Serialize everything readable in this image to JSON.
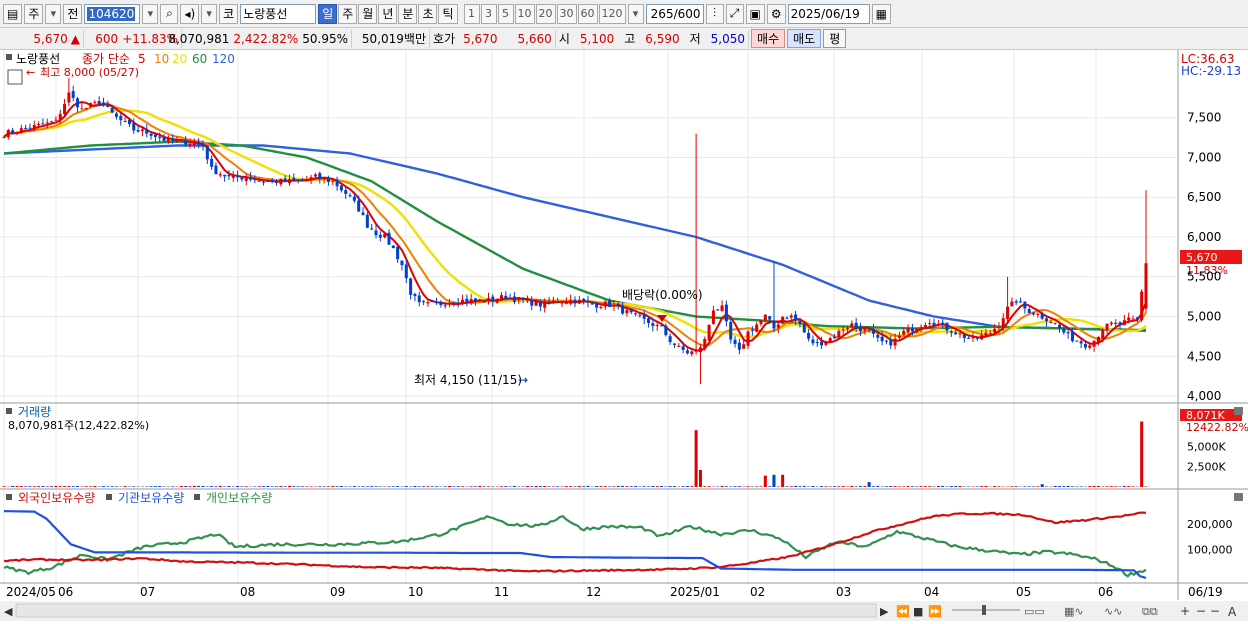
{
  "toolbar": {
    "market_label": "주",
    "prev_label": "전",
    "code_value": "104620",
    "kosdaq_label": "코",
    "name_value": "노랑풍선",
    "periods": [
      "일",
      "주",
      "월",
      "년",
      "분",
      "초",
      "틱"
    ],
    "active_period": "일",
    "intervals": [
      "1",
      "3",
      "5",
      "10",
      "20",
      "30",
      "60",
      "120"
    ],
    "count_value": "265",
    "count_total": "/600",
    "date_value": "2025/06/19"
  },
  "quote": {
    "price": "5,670",
    "up_arrow": "▲",
    "change": "600",
    "change_pct": "+11.83%",
    "volume": "8,070,981",
    "volume_ratio": "2,422.82%",
    "turnover": "50.95%",
    "amount": "50,019백만",
    "bid_label": "호가",
    "ask": "5,670",
    "bid": "5,660",
    "open_label": "시",
    "open": "5,100",
    "high_label": "고",
    "high": "6,590",
    "low_label": "저",
    "low": "5,050",
    "buy_label": "매수",
    "sell_label": "매도",
    "eval_label": "평"
  },
  "price_panel": {
    "stock_name": "노랑풍선",
    "legend_prefix": "종가 단순",
    "ma_periods": [
      "5",
      "10",
      "20",
      "60",
      "120"
    ],
    "ma_colors": [
      "#e00000",
      "#f08000",
      "#f0e000",
      "#209040",
      "#3060e0"
    ],
    "high_annotation": "최고 8,000 (05/27)",
    "low_annotation": "최저 4,150 (11/15)",
    "dividend_annotation": "배당락(0.00%)",
    "lc_label": "LC:36.63",
    "hc_label": "HC:-29.13",
    "current_price_tag": "5,670",
    "current_change_tag": "11.83%",
    "y_ticks": [
      "7,500",
      "7,000",
      "6,500",
      "6,000",
      "5,500",
      "5,000",
      "4,500",
      "4,000"
    ]
  },
  "volume_panel": {
    "title": "거래량",
    "summary": "8,070,981주(12,422.82%)",
    "current_tag": "8,071K",
    "current_pct": "12422.82%",
    "y_ticks": [
      "5,000K",
      "2,500K"
    ]
  },
  "holding_panel": {
    "legend": [
      "외국인보유수량",
      "기관보유수량",
      "개인보유수량"
    ],
    "colors": [
      "#d01010",
      "#2050e0",
      "#309050"
    ],
    "y_ticks": [
      "200,000",
      "100,000"
    ]
  },
  "x_axis": {
    "labels": [
      "2024/05",
      "06",
      "07",
      "08",
      "09",
      "10",
      "11",
      "12",
      "2025/01",
      "02",
      "03",
      "04",
      "05",
      "06"
    ],
    "right_label": "06/19"
  },
  "chart_data": {
    "type": "candlestick",
    "y_range": [
      3950,
      8100
    ],
    "price_anchors": [
      [
        0,
        7300
      ],
      [
        4,
        7350
      ],
      [
        8,
        7400
      ],
      [
        12,
        7450
      ],
      [
        15,
        7800
      ],
      [
        18,
        7600
      ],
      [
        22,
        7700
      ],
      [
        26,
        7500
      ],
      [
        30,
        7350
      ],
      [
        34,
        7300
      ],
      [
        38,
        7200
      ],
      [
        42,
        7200
      ],
      [
        46,
        7150
      ],
      [
        48,
        6850
      ],
      [
        52,
        6750
      ],
      [
        56,
        6750
      ],
      [
        60,
        6700
      ],
      [
        64,
        6700
      ],
      [
        68,
        6700
      ],
      [
        72,
        6750
      ],
      [
        76,
        6700
      ],
      [
        78,
        6600
      ],
      [
        80,
        6500
      ],
      [
        82,
        6350
      ],
      [
        84,
        6150
      ],
      [
        86,
        6050
      ],
      [
        88,
        6000
      ],
      [
        90,
        5850
      ],
      [
        92,
        5650
      ],
      [
        94,
        5300
      ],
      [
        96,
        5150
      ],
      [
        98,
        5150
      ],
      [
        100,
        5150
      ],
      [
        104,
        5200
      ],
      [
        108,
        5200
      ],
      [
        112,
        5200
      ],
      [
        116,
        5250
      ],
      [
        120,
        5200
      ],
      [
        124,
        5150
      ],
      [
        128,
        5200
      ],
      [
        132,
        5200
      ],
      [
        136,
        5150
      ],
      [
        140,
        5150
      ],
      [
        144,
        5050
      ],
      [
        148,
        4950
      ],
      [
        152,
        4850
      ],
      [
        154,
        4700
      ],
      [
        156,
        4600
      ],
      [
        158,
        4550
      ],
      [
        160,
        4550
      ],
      [
        162,
        4700
      ],
      [
        164,
        5100
      ],
      [
        166,
        5100
      ],
      [
        168,
        4700
      ],
      [
        170,
        4550
      ],
      [
        172,
        4800
      ],
      [
        176,
        5000
      ],
      [
        178,
        4850
      ],
      [
        180,
        5000
      ],
      [
        182,
        5000
      ],
      [
        184,
        4900
      ],
      [
        186,
        4700
      ],
      [
        188,
        4650
      ],
      [
        190,
        4700
      ],
      [
        192,
        4750
      ],
      [
        194,
        4850
      ],
      [
        196,
        4900
      ],
      [
        198,
        4850
      ],
      [
        200,
        4800
      ],
      [
        202,
        4700
      ],
      [
        204,
        4650
      ],
      [
        206,
        4700
      ],
      [
        208,
        4800
      ],
      [
        210,
        4850
      ],
      [
        212,
        4900
      ],
      [
        214,
        4950
      ],
      [
        216,
        4900
      ],
      [
        218,
        4850
      ],
      [
        220,
        4800
      ],
      [
        222,
        4750
      ],
      [
        224,
        4700
      ],
      [
        226,
        4750
      ],
      [
        228,
        4800
      ],
      [
        230,
        4900
      ],
      [
        232,
        5100
      ],
      [
        234,
        5200
      ],
      [
        236,
        5100
      ],
      [
        238,
        5050
      ],
      [
        240,
        5000
      ],
      [
        242,
        4950
      ],
      [
        244,
        4850
      ],
      [
        246,
        4750
      ],
      [
        248,
        4700
      ],
      [
        250,
        4650
      ],
      [
        252,
        4700
      ],
      [
        254,
        4850
      ],
      [
        256,
        4900
      ],
      [
        258,
        4900
      ],
      [
        260,
        4950
      ],
      [
        262,
        4950
      ],
      [
        264,
        5670
      ]
    ],
    "ma120_anchors": [
      [
        0,
        7050
      ],
      [
        20,
        7100
      ],
      [
        40,
        7150
      ],
      [
        60,
        7150
      ],
      [
        80,
        7050
      ],
      [
        100,
        6800
      ],
      [
        120,
        6500
      ],
      [
        140,
        6250
      ],
      [
        160,
        6000
      ],
      [
        180,
        5650
      ],
      [
        200,
        5200
      ],
      [
        215,
        5000
      ],
      [
        230,
        4870
      ],
      [
        245,
        4850
      ],
      [
        264,
        4820
      ]
    ],
    "ma60_anchors": [
      [
        0,
        7050
      ],
      [
        20,
        7150
      ],
      [
        40,
        7200
      ],
      [
        55,
        7150
      ],
      [
        70,
        7000
      ],
      [
        85,
        6700
      ],
      [
        100,
        6200
      ],
      [
        120,
        5600
      ],
      [
        140,
        5200
      ],
      [
        160,
        5000
      ],
      [
        175,
        4950
      ],
      [
        190,
        4880
      ],
      [
        210,
        4850
      ],
      [
        230,
        4870
      ],
      [
        245,
        4850
      ],
      [
        264,
        4830
      ]
    ],
    "volume_spikes": [
      [
        160,
        7000
      ],
      [
        161,
        2100
      ],
      [
        176,
        1400
      ],
      [
        178,
        1500
      ],
      [
        180,
        1500
      ],
      [
        200,
        600
      ],
      [
        240,
        350
      ],
      [
        263,
        8071
      ]
    ],
    "foreign_anchors": [
      [
        0,
        55
      ],
      [
        10,
        60
      ],
      [
        30,
        58
      ],
      [
        45,
        65
      ],
      [
        60,
        52
      ],
      [
        80,
        48
      ],
      [
        100,
        40
      ],
      [
        120,
        30
      ],
      [
        140,
        28
      ],
      [
        160,
        20
      ],
      [
        170,
        14
      ],
      [
        180,
        15
      ],
      [
        200,
        18
      ],
      [
        220,
        22
      ],
      [
        235,
        30
      ],
      [
        245,
        45
      ],
      [
        258,
        70
      ],
      [
        266,
        95
      ],
      [
        276,
        130
      ],
      [
        286,
        170
      ],
      [
        296,
        200
      ],
      [
        306,
        230
      ],
      [
        316,
        240
      ],
      [
        326,
        240
      ],
      [
        336,
        235
      ],
      [
        346,
        205
      ],
      [
        356,
        215
      ],
      [
        368,
        230
      ],
      [
        376,
        245
      ]
    ],
    "inst_anchors": [
      [
        0,
        250
      ],
      [
        10,
        248
      ],
      [
        14,
        220
      ],
      [
        22,
        120
      ],
      [
        30,
        88
      ],
      [
        60,
        88
      ],
      [
        100,
        87
      ],
      [
        130,
        87
      ],
      [
        150,
        86
      ],
      [
        170,
        86
      ],
      [
        180,
        70
      ],
      [
        200,
        68
      ],
      [
        230,
        66
      ],
      [
        236,
        25
      ],
      [
        260,
        20
      ],
      [
        290,
        20
      ],
      [
        320,
        20
      ],
      [
        352,
        20
      ],
      [
        372,
        18
      ],
      [
        374,
        -5
      ],
      [
        376,
        -12
      ]
    ],
    "indiv_anchors": [
      [
        0,
        30
      ],
      [
        8,
        10
      ],
      [
        16,
        30
      ],
      [
        26,
        80
      ],
      [
        34,
        60
      ],
      [
        46,
        110
      ],
      [
        60,
        130
      ],
      [
        70,
        160
      ],
      [
        76,
        110
      ],
      [
        90,
        120
      ],
      [
        110,
        120
      ],
      [
        130,
        130
      ],
      [
        144,
        160
      ],
      [
        160,
        230
      ],
      [
        166,
        200
      ],
      [
        176,
        190
      ],
      [
        184,
        230
      ],
      [
        190,
        180
      ],
      [
        200,
        190
      ],
      [
        210,
        185
      ],
      [
        216,
        150
      ],
      [
        226,
        190
      ],
      [
        236,
        160
      ],
      [
        246,
        175
      ],
      [
        256,
        140
      ],
      [
        264,
        70
      ],
      [
        274,
        130
      ],
      [
        284,
        110
      ],
      [
        294,
        170
      ],
      [
        304,
        140
      ],
      [
        314,
        110
      ],
      [
        324,
        95
      ],
      [
        334,
        80
      ],
      [
        344,
        90
      ],
      [
        352,
        80
      ],
      [
        360,
        60
      ],
      [
        366,
        30
      ],
      [
        370,
        0
      ],
      [
        376,
        20
      ]
    ]
  }
}
